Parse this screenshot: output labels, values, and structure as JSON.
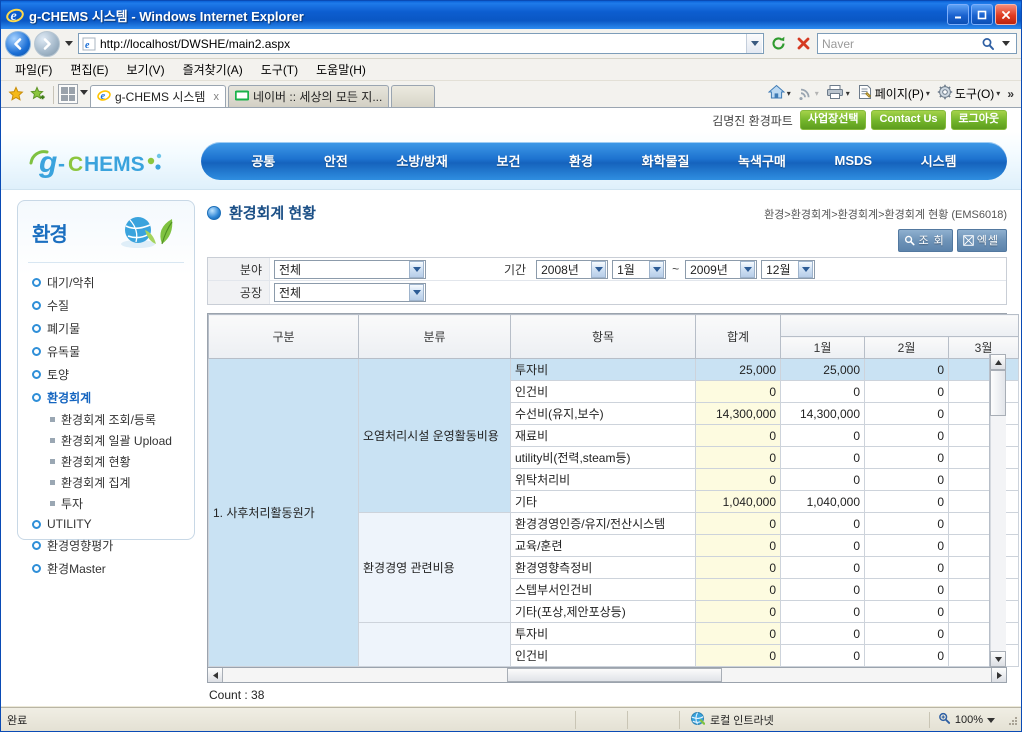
{
  "window": {
    "title": "g-CHEMS 시스템 - Windows Internet Explorer",
    "minimize_label": "최소화",
    "maximize_label": "최대화",
    "close_label": "닫기"
  },
  "browser": {
    "back_label": "뒤로",
    "forward_label": "앞으로",
    "url": "http://localhost/DWSHE/main2.aspx",
    "url_dropdown_label": "주소 목록",
    "refresh_label": "새로 고침",
    "stop_label": "중지",
    "search_placeholder": "Naver",
    "search_value": "",
    "search_button_label": "검색",
    "menus": [
      {
        "label": "파일(F)",
        "text": "파일",
        "accel": "F"
      },
      {
        "label": "편집(E)",
        "text": "편집",
        "accel": "E"
      },
      {
        "label": "보기(V)",
        "text": "보기",
        "accel": "V"
      },
      {
        "label": "즐겨찾기(A)",
        "text": "즐겨찾기",
        "accel": "A"
      },
      {
        "label": "도구(T)",
        "text": "도구",
        "accel": "T"
      },
      {
        "label": "도움말(H)",
        "text": "도움말",
        "accel": "H"
      }
    ],
    "tabs": [
      {
        "label": "g-CHEMS 시스템",
        "active": true,
        "close_label": "x"
      },
      {
        "label": "네이버 :: 세상의 모든 지...",
        "active": false
      }
    ],
    "toolbar_right": [
      {
        "label": "홈",
        "icon": "home-icon"
      },
      {
        "label": "피드",
        "icon": "rss-icon"
      },
      {
        "label": "인쇄",
        "icon": "print-icon"
      },
      {
        "label": "페이지(P)",
        "icon": "page-icon"
      },
      {
        "label": "도구(O)",
        "icon": "tools-gear-icon"
      }
    ],
    "overflow_label": "»"
  },
  "statusbar": {
    "status": "완료",
    "zone": "로컬 인트라넷",
    "zoom": "100%"
  },
  "site": {
    "logo_text": "g-CHEMS",
    "user": "김명진 환경파트",
    "buttons": [
      {
        "label": "사업장선택"
      },
      {
        "label": "Contact Us"
      },
      {
        "label": "로그아웃"
      }
    ],
    "nav": [
      {
        "label": "공통"
      },
      {
        "label": "안전"
      },
      {
        "label": "소방/방재"
      },
      {
        "label": "보건"
      },
      {
        "label": "환경"
      },
      {
        "label": "화학물질"
      },
      {
        "label": "녹색구매"
      },
      {
        "label": "MSDS"
      },
      {
        "label": "시스템"
      }
    ]
  },
  "sidebar": {
    "title": "환경",
    "items": [
      {
        "label": "대기/악취",
        "current": false
      },
      {
        "label": "수질",
        "current": false
      },
      {
        "label": "폐기물",
        "current": false
      },
      {
        "label": "유독물",
        "current": false
      },
      {
        "label": "토양",
        "current": false
      },
      {
        "label": "환경회계",
        "current": true
      }
    ],
    "subitems": [
      {
        "label": "환경회계 조회/등록"
      },
      {
        "label": "환경회계 일괄 Upload"
      },
      {
        "label": "환경회계 현황"
      },
      {
        "label": "환경회계 집계"
      },
      {
        "label": "투자"
      }
    ],
    "items_after": [
      {
        "label": "UTILITY",
        "current": false
      },
      {
        "label": "환경영향평가",
        "current": false
      },
      {
        "label": "환경Master",
        "current": false
      }
    ]
  },
  "page": {
    "title": "환경회계 현황",
    "breadcrumb": "환경>환경회계>환경회계>환경회계 현황 (EMS6018)",
    "actions": [
      {
        "label": "조 회",
        "icon": "search-icon"
      },
      {
        "label": "엑셀",
        "icon": "excel-icon"
      }
    ]
  },
  "filters": {
    "field_label": "분야",
    "field_value": "전체",
    "period_label": "기간",
    "period_from_year": "2008년",
    "period_from_month": "1월",
    "period_separator": "~",
    "period_to_year": "2009년",
    "period_to_month": "12월",
    "plant_label": "공장",
    "plant_value": "전체"
  },
  "grid": {
    "columns": [
      "구분",
      "분류",
      "항목",
      "합계",
      "1월",
      "2월",
      "3월"
    ],
    "month_group_label": "",
    "group_label": "1. 사후처리활동원가",
    "categories": [
      {
        "label": "오염처리시설 운영활동비용",
        "rowspan": 7
      },
      {
        "label": "환경경영 관련비용",
        "rowspan": 5
      },
      {
        "label": "",
        "rowspan": 2
      }
    ],
    "rows": [
      {
        "item": "투자비",
        "sum": "25,000",
        "m1": "25,000",
        "m2": "0",
        "m3": "",
        "selected": true
      },
      {
        "item": "인건비",
        "sum": "0",
        "m1": "0",
        "m2": "0",
        "m3": ""
      },
      {
        "item": "수선비(유지,보수)",
        "sum": "14,300,000",
        "m1": "14,300,000",
        "m2": "0",
        "m3": ""
      },
      {
        "item": "재료비",
        "sum": "0",
        "m1": "0",
        "m2": "0",
        "m3": ""
      },
      {
        "item": "utility비(전력,steam등)",
        "sum": "0",
        "m1": "0",
        "m2": "0",
        "m3": ""
      },
      {
        "item": "위탁처리비",
        "sum": "0",
        "m1": "0",
        "m2": "0",
        "m3": ""
      },
      {
        "item": "기타",
        "sum": "1,040,000",
        "m1": "1,040,000",
        "m2": "0",
        "m3": ""
      },
      {
        "item": "환경경영인증/유지/전산시스템",
        "sum": "0",
        "m1": "0",
        "m2": "0",
        "m3": ""
      },
      {
        "item": "교육/훈련",
        "sum": "0",
        "m1": "0",
        "m2": "0",
        "m3": ""
      },
      {
        "item": "환경영향측정비",
        "sum": "0",
        "m1": "0",
        "m2": "0",
        "m3": ""
      },
      {
        "item": "스텝부서인건비",
        "sum": "0",
        "m1": "0",
        "m2": "0",
        "m3": ""
      },
      {
        "item": "기타(포상,제안포상등)",
        "sum": "0",
        "m1": "0",
        "m2": "0",
        "m3": ""
      },
      {
        "item": "투자비",
        "sum": "0",
        "m1": "0",
        "m2": "0",
        "m3": ""
      },
      {
        "item": "인건비",
        "sum": "0",
        "m1": "0",
        "m2": "0",
        "m3": ""
      }
    ],
    "count_label": "Count : 38",
    "scroll_up_label": "위로",
    "scroll_down_label": "아래로",
    "scroll_left_label": "왼쪽",
    "scroll_right_label": "오른쪽"
  },
  "colors": {
    "accent_blue": "#1563bd",
    "nav_blue": "#1d72cf",
    "green_button": "#72b52a",
    "sum_column": "#fdfbe0",
    "selected_row": "#c9e2f3",
    "title_blue": "#1b4f86"
  }
}
